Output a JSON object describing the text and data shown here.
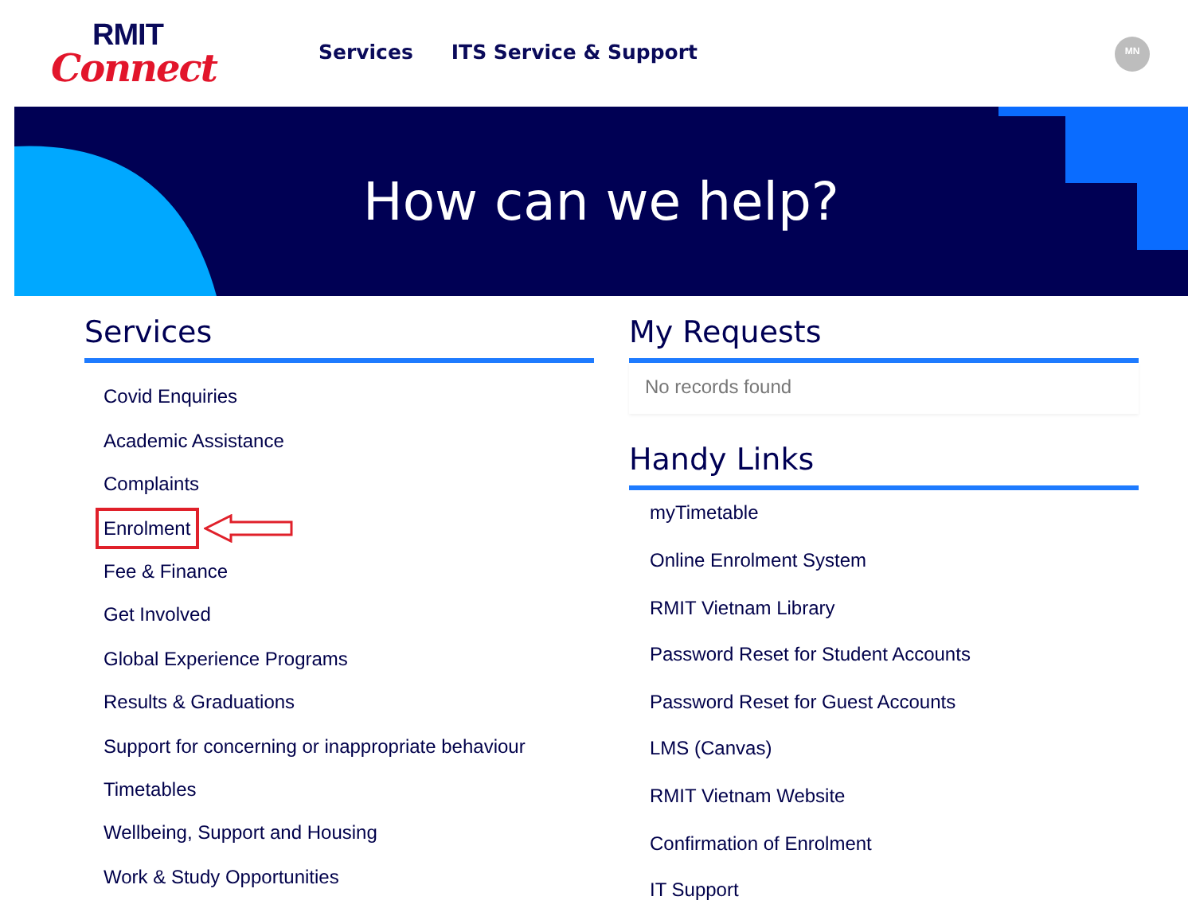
{
  "logo": {
    "line_1": "RMIT",
    "line_2": "Connect"
  },
  "nav": [
    "Services",
    "ITS Service & Support"
  ],
  "avatar": {
    "initials": "MN"
  },
  "banner": {
    "title": "How can we help?"
  },
  "services": {
    "title": "Services",
    "items": [
      {
        "label": "Covid Enquiries",
        "highlighted": false
      },
      {
        "label": "Academic Assistance",
        "highlighted": false
      },
      {
        "label": "Complaints",
        "highlighted": false
      },
      {
        "label": "Enrolment",
        "highlighted": true
      },
      {
        "label": "Fee & Finance",
        "highlighted": false
      },
      {
        "label": "Get Involved",
        "highlighted": false
      },
      {
        "label": "Global Experience Programs",
        "highlighted": false
      },
      {
        "label": "Results & Graduations",
        "highlighted": false
      },
      {
        "label": "Support for concerning or inappropriate behaviour",
        "highlighted": false
      },
      {
        "label": "Timetables",
        "highlighted": false
      },
      {
        "label": "Wellbeing, Support and Housing",
        "highlighted": false
      },
      {
        "label": "Work & Study Opportunities",
        "highlighted": false
      }
    ]
  },
  "requests": {
    "title": "My Requests",
    "empty_text": "No records found"
  },
  "handy_links": {
    "title": "Handy Links",
    "items": [
      "myTimetable",
      "Online Enrolment System",
      "RMIT Vietnam Library",
      "Password Reset for Student Accounts",
      "Password Reset for Guest Accounts",
      "LMS (Canvas)",
      "RMIT Vietnam Website",
      "Confirmation of Enrolment",
      "IT Support"
    ]
  }
}
